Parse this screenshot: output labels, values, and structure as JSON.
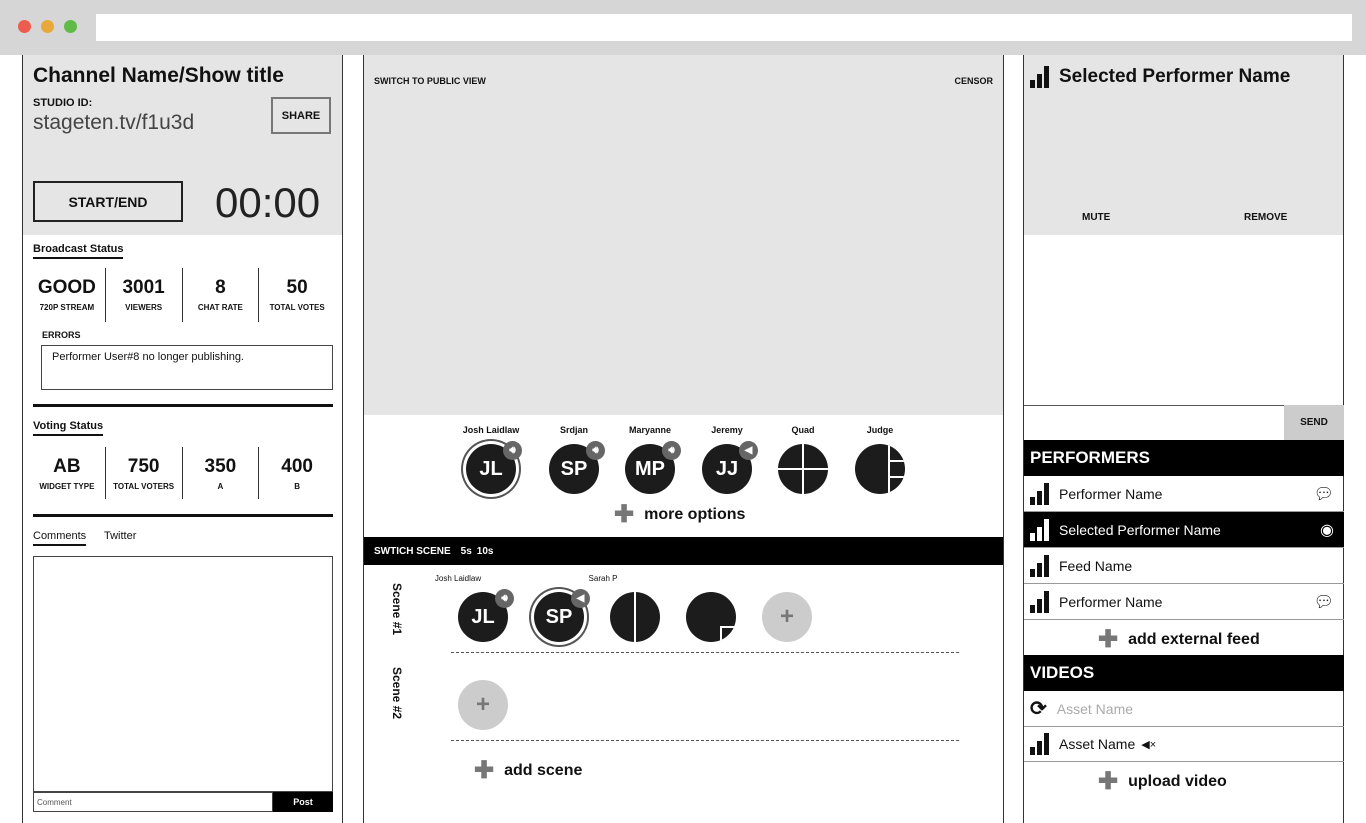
{
  "left": {
    "title": "Channel Name/Show title",
    "studio_label": "STUDIO ID:",
    "studio_url": "stageten.tv/f1u3d",
    "share": "SHARE",
    "start_end": "START/END",
    "timer": "00:00",
    "broadcast_title": "Broadcast Status",
    "broadcast_stats": [
      {
        "value": "GOOD",
        "label": "720P STREAM"
      },
      {
        "value": "3001",
        "label": "VIEWERS"
      },
      {
        "value": "8",
        "label": "CHAT RATE"
      },
      {
        "value": "50",
        "label": "TOTAL VOTES"
      }
    ],
    "errors_label": "ERRORS",
    "error_text": "Performer User#8 no longer publishing.",
    "voting_title": "Voting Status",
    "voting_stats": [
      {
        "value": "AB",
        "label": "WIDGET TYPE"
      },
      {
        "value": "750",
        "label": "TOTAL VOTERS"
      },
      {
        "value": "350",
        "label": "A"
      },
      {
        "value": "400",
        "label": "B"
      }
    ],
    "tabs": [
      "Comments",
      "Twitter"
    ],
    "comment_placeholder": "Comment",
    "post": "Post"
  },
  "center": {
    "public_view": "SWITCH TO PUBLIC VIEW",
    "censor": "CENSOR",
    "sources": [
      {
        "name": "Josh Laidlaw",
        "initials": "JL"
      },
      {
        "name": "Srdjan",
        "initials": "SP"
      },
      {
        "name": "Maryanne",
        "initials": "MP"
      },
      {
        "name": "Jeremy",
        "initials": "JJ"
      },
      {
        "name": "Quad",
        "initials": ""
      },
      {
        "name": "Judge",
        "initials": ""
      }
    ],
    "more_options": "more options",
    "switch_scene": "SWTICH SCENE",
    "t5": "5s",
    "t10": "10s",
    "scenes": [
      {
        "label": "Scene #1",
        "items": [
          {
            "name": "Josh Laidlaw",
            "initials": "JL"
          },
          {
            "name": "Sarah P",
            "initials": "SP"
          }
        ]
      },
      {
        "label": "Scene #2"
      }
    ],
    "add_scene": "add scene",
    "plus": "+"
  },
  "right": {
    "selected_name": "Selected Performer Name",
    "mute": "MUTE",
    "remove": "REMOVE",
    "send": "SEND",
    "performers_title": "PERFORMERS",
    "performers": [
      "Performer Name",
      "Selected Performer Name",
      "Feed Name",
      "Performer Name"
    ],
    "add_feed": "add external feed",
    "videos_title": "VIDEOS",
    "videos": [
      "Asset Name",
      "Asset Name"
    ],
    "upload": "upload video"
  }
}
